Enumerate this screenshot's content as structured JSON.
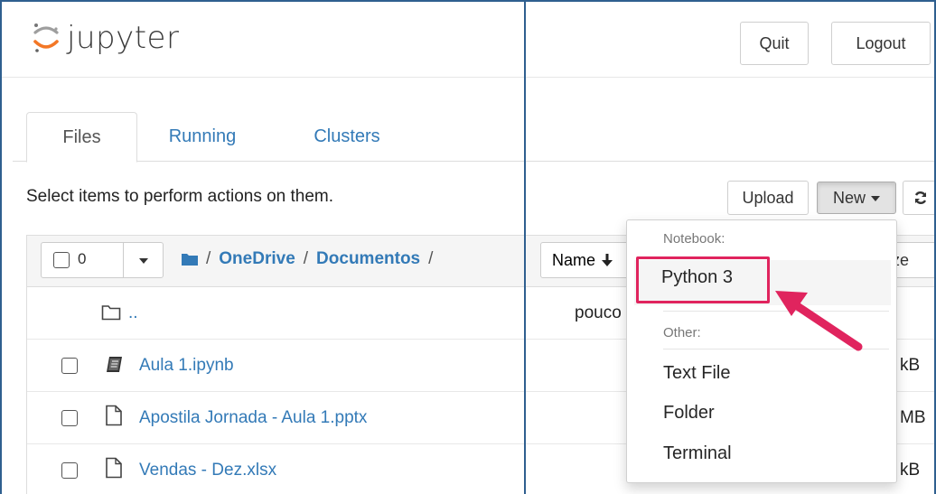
{
  "header": {
    "logo_text": "jupyter",
    "quit_label": "Quit",
    "logout_label": "Logout"
  },
  "tabs": [
    {
      "label": "Files",
      "active": true
    },
    {
      "label": "Running",
      "active": false
    },
    {
      "label": "Clusters",
      "active": false
    }
  ],
  "toolbar": {
    "hint": "Select items to perform actions on them.",
    "upload_label": "Upload",
    "new_label": "New",
    "refresh_icon": "refresh-icon"
  },
  "list_header": {
    "selected_count": "0",
    "breadcrumb": [
      "OneDrive",
      "Documentos"
    ],
    "sort_label": "Name",
    "size_label": "ze"
  },
  "files": [
    {
      "name": "..",
      "icon": "folder-icon",
      "right": "pouco",
      "has_checkbox": false
    },
    {
      "name": "Aula 1.ipynb",
      "icon": "notebook-icon",
      "right": "kB",
      "has_checkbox": true
    },
    {
      "name": "Apostila Jornada - Aula 1.pptx",
      "icon": "file-icon",
      "right": "MB",
      "has_checkbox": true
    },
    {
      "name": "Vendas - Dez.xlsx",
      "icon": "file-icon",
      "right": "kB",
      "has_checkbox": true
    }
  ],
  "new_menu": {
    "notebook_header": "Notebook:",
    "notebook_items": [
      "Python 3"
    ],
    "other_header": "Other:",
    "other_items": [
      "Text File",
      "Folder",
      "Terminal"
    ]
  },
  "colors": {
    "link": "#337ab7",
    "highlight": "#e0245e",
    "frame": "#2f5f8f"
  }
}
